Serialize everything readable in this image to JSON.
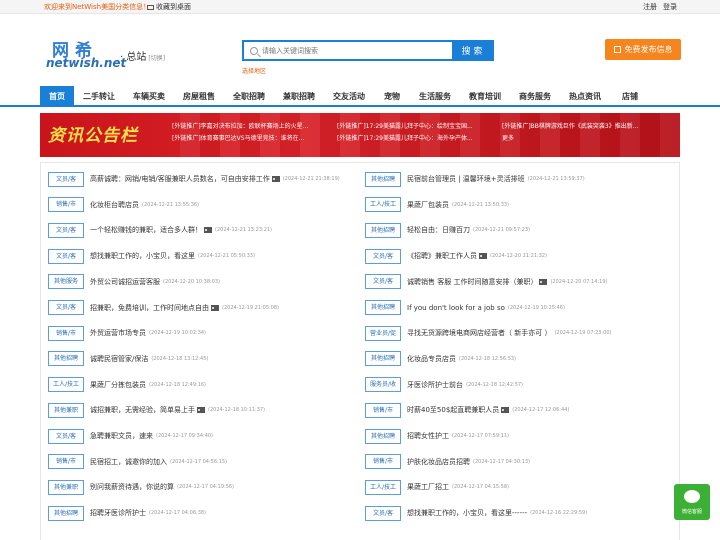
{
  "topbar": {
    "welcome": "欢迎来到NetWish美国分类信息！",
    "favorite": "收藏到桌面",
    "register": "注册",
    "login": "登录"
  },
  "header": {
    "logo_cn": "网希",
    "logo_en": "netwish.net",
    "city": "· 总站",
    "city_switch": "[切换]",
    "search_placeholder": "请输入关键词搜索",
    "search_button": "搜 索",
    "search_area": "选择地区",
    "post_button": "免费发布信息"
  },
  "nav": {
    "items": [
      {
        "label": "首页",
        "active": true
      },
      {
        "label": "二手转让"
      },
      {
        "label": "车辆买卖"
      },
      {
        "label": "房屋租售"
      },
      {
        "label": "全职招聘"
      },
      {
        "label": "兼职招聘"
      },
      {
        "label": "交友活动"
      },
      {
        "label": "宠物"
      },
      {
        "label": "生活服务"
      },
      {
        "label": "教育培训"
      },
      {
        "label": "商务服务"
      },
      {
        "label": "热点资讯"
      },
      {
        "label": "店铺"
      }
    ]
  },
  "banner": {
    "title": "资讯公告栏",
    "notices": [
      "[外链推广]李嘉对决布拉加：欧联杯赛场上的火星...",
      "[外链推广]17:29美猫露儿拜子中心：绘制宝宝国...",
      "[外链推广]BB棋牌游戏巨作《武装突袭3》推出新...",
      "[外链推广]体育赛事巴达VS马德里竞技：谁将在...",
      "[外链推广]17:29美猫露儿拜子中心：海外孕产体...",
      "更多"
    ]
  },
  "listings": {
    "left": [
      {
        "tag": "文员/客",
        "title": "高薪诚聘：网销/电销/客服兼职人员数名，可自由安排工作",
        "pic": true,
        "date": "(2024-12-21 21:38:19)"
      },
      {
        "tag": "销售/市",
        "title": "化妆柜台聘店员",
        "pic": false,
        "date": "(2024-12-21 13:55:36)"
      },
      {
        "tag": "文员/客",
        "title": "一个轻松赚钱的兼职，适合多人群！",
        "pic": true,
        "date": "(2024-12-21 13:23:21)"
      },
      {
        "tag": "文员/客",
        "title": "想找兼职工作的，小宝贝，看这里",
        "pic": false,
        "date": "(2024-12-21 05:50:33)"
      },
      {
        "tag": "其他服务",
        "title": "外贸公司诚招运营客服",
        "pic": false,
        "date": "(2024-12-20 10:38:03)"
      },
      {
        "tag": "文员/客",
        "title": "招兼职，免费培训，工作时间地点自由",
        "pic": true,
        "date": "(2024-12-19 21:05:08)"
      },
      {
        "tag": "销售/市",
        "title": "外贸运营市场专员",
        "pic": false,
        "date": "(2024-12-19 10:02:34)"
      },
      {
        "tag": "其他招聘",
        "title": "诚聘民宿管家/保洁",
        "pic": false,
        "date": "(2024-12-18 13:12:45)"
      },
      {
        "tag": "工人/技工",
        "title": "果蔬厂分拣包装员",
        "pic": false,
        "date": "(2024-12-18 12:49:16)"
      },
      {
        "tag": "其他兼职",
        "title": "诚招兼职，无需经验，简单易上手",
        "pic": true,
        "date": "(2024-12-18 10:11:37)"
      },
      {
        "tag": "文员/客",
        "title": "急聘兼职文员，速来",
        "pic": false,
        "date": "(2024-12-17 09:34:40)"
      },
      {
        "tag": "销售/市",
        "title": "民宿招工，诚邀你的加入",
        "pic": false,
        "date": "(2024-12-17 04:56:15)"
      },
      {
        "tag": "其他兼职",
        "title": "别问我薪资待遇，你说的算",
        "pic": false,
        "date": "(2024-12-17 04:19:56)"
      },
      {
        "tag": "其他招聘",
        "title": "招聘牙医诊所护士",
        "pic": false,
        "date": "(2024-12-17 04:06:38)"
      }
    ],
    "right": [
      {
        "tag": "其他招聘",
        "title": "民宿前台管理员 | 温馨环境+灵活排班",
        "pic": false,
        "date": "(2024-12-21 13:59:37)"
      },
      {
        "tag": "工人/技工",
        "title": "果蔬厂包装员",
        "pic": false,
        "date": "(2024-12-21 13:50:33)"
      },
      {
        "tag": "其他招聘",
        "title": "轻松自由：日赚百刀",
        "pic": false,
        "date": "(2024-12-21 09:57:23)"
      },
      {
        "tag": "文员/客",
        "title": "《招聘》兼职工作人员",
        "pic": true,
        "date": "(2024-12-20 21:21:32)"
      },
      {
        "tag": "文员/客",
        "title": "诚聘销售 客服 工作时间随意安排（兼职）",
        "pic": true,
        "date": "(2024-12-20 07:14:19)"
      },
      {
        "tag": "其他招聘",
        "title": "If you don't look for a job so",
        "pic": false,
        "date": "(2024-12-19 10:25:46)"
      },
      {
        "tag": "营业员/促",
        "title": "寻找无货源跨境电商网店经营者（ 新手亦可 ）",
        "pic": false,
        "date": "(2024-12-19 07:23:00)"
      },
      {
        "tag": "其他招聘",
        "title": "化妆品专员店员",
        "pic": false,
        "date": "(2024-12-18 12:56:53)"
      },
      {
        "tag": "服务员/收",
        "title": "牙医诊所护士前台",
        "pic": false,
        "date": "(2024-12-18 12:42:57)"
      },
      {
        "tag": "销售/市",
        "title": "时薪40至50$起直聘兼职人员",
        "pic": true,
        "date": "(2024-12-17 12:06:44)"
      },
      {
        "tag": "其他招聘",
        "title": "招聘女性护工",
        "pic": false,
        "date": "(2024-12-17 07:59:11)"
      },
      {
        "tag": "销售/市",
        "title": "护肤化妆品店员招聘",
        "pic": false,
        "date": "(2024-12-17 04:30:13)"
      },
      {
        "tag": "工人/技工",
        "title": "果蔬工厂招工",
        "pic": false,
        "date": "(2024-12-17 04:15:58)"
      },
      {
        "tag": "文员/客",
        "title": "想找兼职工作的，小宝贝，看这里------",
        "pic": false,
        "date": "(2024-12-16 22:29:59)"
      }
    ]
  },
  "wechat": {
    "label": "微信客服"
  }
}
